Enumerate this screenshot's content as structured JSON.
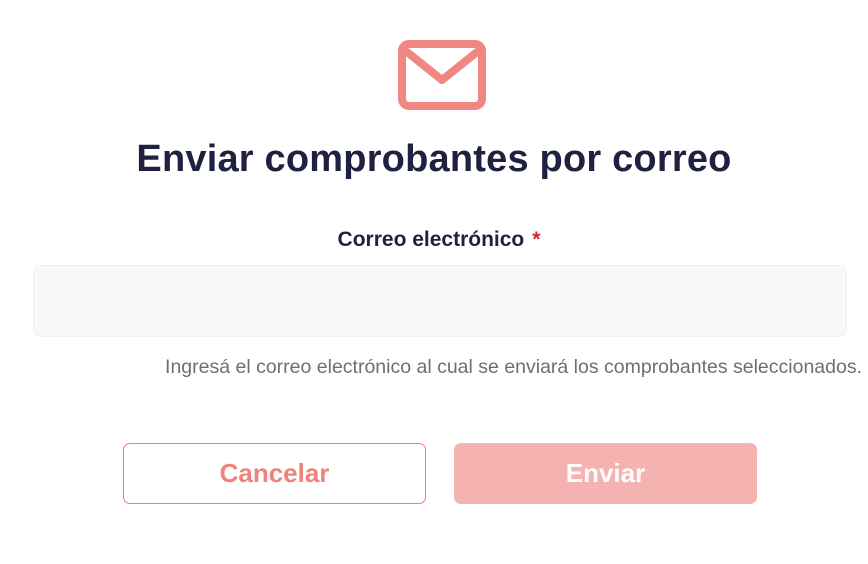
{
  "header": {
    "icon": "mail-icon",
    "title": "Enviar comprobantes por correo"
  },
  "form": {
    "email_label": "Correo electrónico",
    "required_mark": "*",
    "email_value": "",
    "email_placeholder": "",
    "hint": "Ingresá el correo electrónico al cual se enviará los comprobantes seleccionados."
  },
  "actions": {
    "cancel_label": "Cancelar",
    "send_label": "Enviar"
  },
  "colors": {
    "accent": "#F08783",
    "accent_disabled": "#F4B3B1",
    "title": "#1F2140",
    "required": "#D12A2A",
    "hint": "#6F6F6F"
  }
}
